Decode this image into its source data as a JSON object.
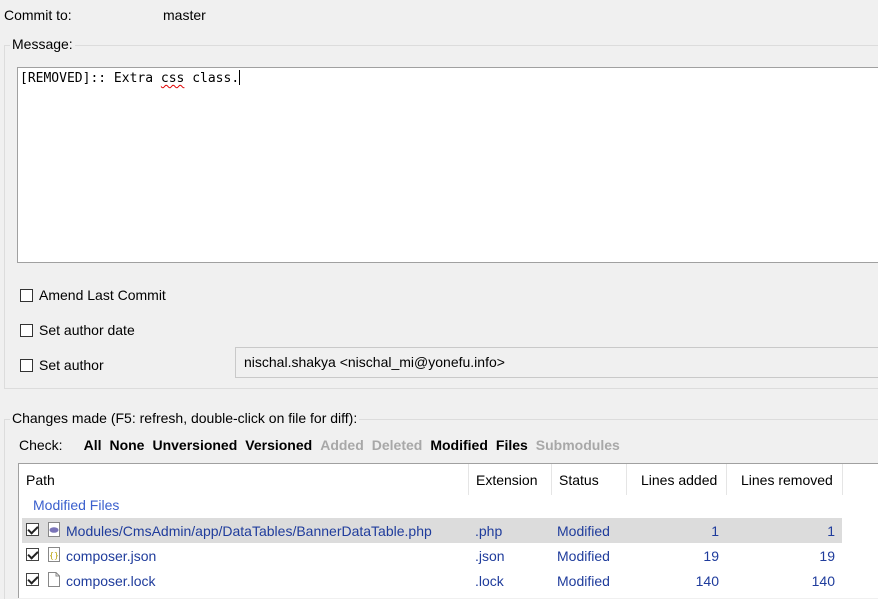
{
  "commit": {
    "label": "Commit to:",
    "branch": "master"
  },
  "message": {
    "group_title": "Message:",
    "text_prefix": "[REMOVED]:: Extra ",
    "text_misspelled": "css",
    "text_suffix": " class."
  },
  "options": {
    "amend_label": "Amend Last Commit",
    "author_date_label": "Set author date",
    "author_label": "Set author",
    "author_value": "nischal.shakya <nischal_mi@yonefu.info>"
  },
  "changes": {
    "group_title": "Changes made (F5: refresh, double-click on file for diff):",
    "check_label": "Check:",
    "filters": [
      {
        "label": "All",
        "enabled": true
      },
      {
        "label": "None",
        "enabled": true
      },
      {
        "label": "Unversioned",
        "enabled": true
      },
      {
        "label": "Versioned",
        "enabled": true
      },
      {
        "label": "Added",
        "enabled": false
      },
      {
        "label": "Deleted",
        "enabled": false
      },
      {
        "label": "Modified",
        "enabled": true
      },
      {
        "label": "Files",
        "enabled": true
      },
      {
        "label": "Submodules",
        "enabled": false
      }
    ],
    "columns": {
      "path": "Path",
      "extension": "Extension",
      "status": "Status",
      "added": "Lines added",
      "removed": "Lines removed"
    },
    "group_label": "Modified Files",
    "files": [
      {
        "path": "Modules/CmsAdmin/app/DataTables/BannerDataTable.php",
        "extension": ".php",
        "status": "Modified",
        "added": "1",
        "removed": "1",
        "icon": "php-file-icon",
        "checked": true,
        "selected": true
      },
      {
        "path": "composer.json",
        "extension": ".json",
        "status": "Modified",
        "added": "19",
        "removed": "19",
        "icon": "json-file-icon",
        "checked": true,
        "selected": false
      },
      {
        "path": "composer.lock",
        "extension": ".lock",
        "status": "Modified",
        "added": "140",
        "removed": "140",
        "icon": "file-icon",
        "checked": true,
        "selected": false
      }
    ]
  }
}
